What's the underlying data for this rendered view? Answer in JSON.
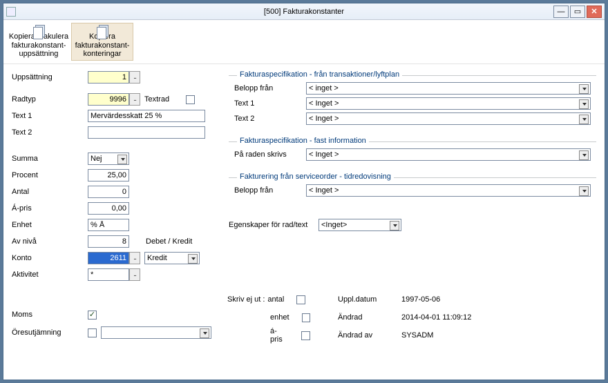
{
  "window": {
    "title": "[500]  Fakturakonstanter"
  },
  "toolbar": {
    "copy_makulera": "Kopiera/Makulera fakturakonstant- uppsättning",
    "copy_konteringar": "Kopiera fakturakonstant- konteringar"
  },
  "labels": {
    "uppsattning": "Uppsättning",
    "radtyp": "Radtyp",
    "textrad": "Textrad",
    "text1": "Text 1",
    "text2": "Text 2",
    "summa": "Summa",
    "procent": "Procent",
    "antal": "Antal",
    "apris": "Á-pris",
    "enhet": "Enhet",
    "av_niva": "Av nivå",
    "konto": "Konto",
    "aktivitet": "Aktivitet",
    "debet_kredit": "Debet / Kredit",
    "egenskaper": "Egenskaper för rad/text",
    "moms": "Moms",
    "oresutjamning": "Öresutjämning",
    "skriv_ej_ut": "Skriv ej ut :",
    "skriv_antal": "antal",
    "skriv_enhet": "enhet",
    "skriv_apris": "á-pris",
    "uppl_datum": "Uppl.datum",
    "andrad": "Ändrad",
    "andrad_av": "Ändrad av"
  },
  "values": {
    "uppsattning": "1",
    "radtyp": "9996",
    "text1": "Mervärdesskatt 25 %",
    "text2": "",
    "summa": "Nej",
    "procent": "25,00",
    "antal": "0",
    "apris": "0,00",
    "enhet": "% Å",
    "av_niva": "8",
    "konto": "2611",
    "aktivitet": "*",
    "debet_kredit": "Kredit",
    "egenskaper": "<Inget>",
    "oresutjamning_select": ""
  },
  "groups": {
    "spec_trans": {
      "title": "Fakturaspecifikation - från transaktioner/lyftplan",
      "belopp_fran_label": "Belopp från",
      "belopp_fran": "< inget >",
      "text1_label": "Text 1",
      "text1": "< Inget >",
      "text2_label": "Text 2",
      "text2": "< Inget >"
    },
    "spec_fast": {
      "title": "Fakturaspecifikation - fast information",
      "pa_raden_label": "På raden skrivs",
      "pa_raden": "< Inget >"
    },
    "service": {
      "title": "Fakturering från serviceorder - tidredovisning",
      "belopp_fran_label": "Belopp från",
      "belopp_fran": "< Inget >"
    }
  },
  "meta": {
    "uppl_datum": "1997-05-06",
    "andrad": "2014-04-01 11:09:12",
    "andrad_av": "SYSADM"
  }
}
